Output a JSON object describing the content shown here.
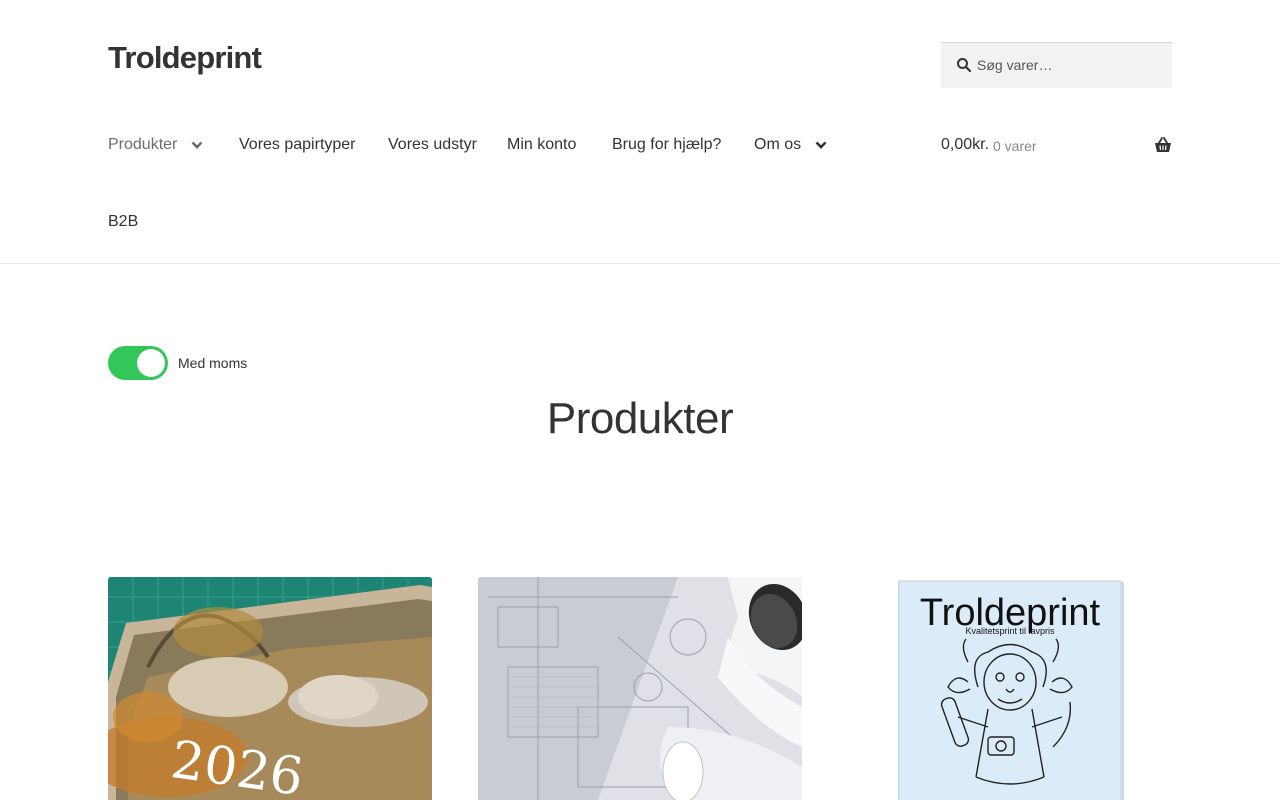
{
  "site": {
    "title": "Troldeprint"
  },
  "search": {
    "placeholder": "Søg varer…"
  },
  "nav": {
    "items": [
      {
        "label": "Produkter"
      },
      {
        "label": "Vores papirtyper"
      },
      {
        "label": "Vores udstyr"
      },
      {
        "label": "Min konto"
      },
      {
        "label": "Brug for hjælp?"
      },
      {
        "label": "Om os"
      },
      {
        "label": "B2B"
      }
    ]
  },
  "cart": {
    "amount": "0,00kr.",
    "count": "0 varer"
  },
  "vat_toggle": {
    "label": "Med moms",
    "on": true,
    "color": "#33c759"
  },
  "main": {
    "heading": "Produkter"
  },
  "products": [
    {
      "image_text": "2026"
    },
    {
      "image_text": ""
    },
    {
      "image_text": "Troldeprint",
      "image_subtext": "Kvalitetsprint til lavpris"
    }
  ],
  "icons": {
    "search": "search-icon",
    "cart": "basket-icon",
    "dropdown": "chevron-down-icon"
  }
}
